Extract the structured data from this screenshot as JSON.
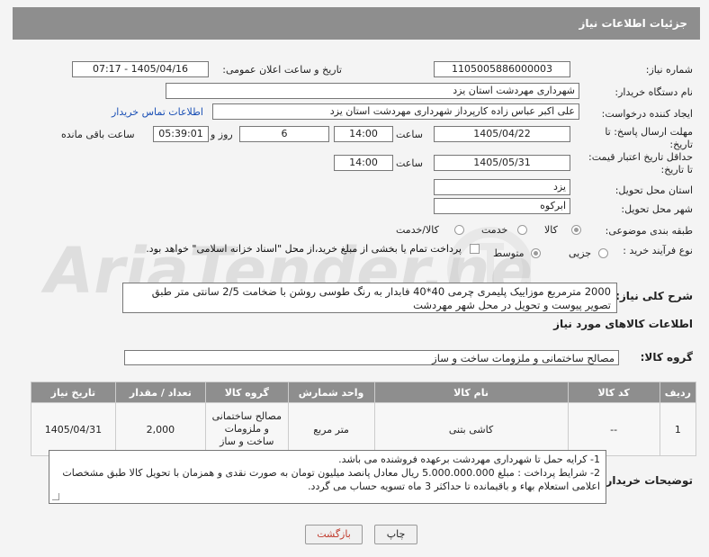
{
  "header": {
    "title": "جزئیات اطلاعات نیاز"
  },
  "form": {
    "need_number_label": "شماره نیاز:",
    "need_number": "1105005886000003",
    "announce_label": "تاریخ و ساعت اعلان عمومی:",
    "announce_value": "1405/04/16 - 07:17",
    "buyer_org_label": "نام دستگاه خریدار:",
    "buyer_org": "شهرداری مهردشت استان یزد",
    "creator_label": "ایجاد کننده درخواست:",
    "creator": "علی اکبر عباس زاده کارپرداز شهرداری مهردشت استان یزد",
    "contact_link": "اطلاعات تماس خریدار",
    "deadline_label_1": "مهلت ارسال پاسخ: تا",
    "deadline_label_2": "تاریخ:",
    "deadline_date": "1405/04/22",
    "time_label": "ساعت",
    "deadline_time": "14:00",
    "days_value": "6",
    "days_label": "روز و",
    "remaining_time": "05:39:01",
    "remaining_label": "ساعت باقی مانده",
    "price_valid_label_1": "حداقل تاریخ اعتبار قیمت:",
    "price_valid_label_2": "تا تاریخ:",
    "price_valid_date": "1405/05/31",
    "price_valid_time": "14:00",
    "province_label": "استان محل تحویل:",
    "province": "یزد",
    "city_label": "شهر محل تحویل:",
    "city": "ابرکوه",
    "category_label": "طبقه بندی موضوعی:",
    "category_options": [
      "کالا",
      "خدمت",
      "کالا/خدمت"
    ],
    "purchase_type_label": "نوع فرآیند خرید :",
    "purchase_options": [
      "جزیی",
      "متوسط"
    ],
    "payment_note": "پرداخت تمام یا بخشی از مبلغ خرید،از محل \"اسناد خزانه اسلامی\" خواهد بود."
  },
  "description": {
    "label": "شرح کلی نیاز:",
    "text": "2000 مترمربع موزاییک پلیمری چرمی 40*40 فابدار به رنگ طوسی روشن با ضخامت 2/5 سانتی متر طبق تصویر پیوست و تحویل در محل شهر مهردشت"
  },
  "goods_section_title": "اطلاعات کالاهای مورد نیاز",
  "goods_group": {
    "label": "گروه کالا:",
    "value": "مصالح ساختمانی و ملزومات ساخت و ساز"
  },
  "table": {
    "headers": [
      "ردیف",
      "کد کالا",
      "نام کالا",
      "واحد شمارش",
      "گروه کالا",
      "تعداد / مقدار",
      "تاریخ نیاز"
    ],
    "rows": [
      [
        "1",
        "--",
        "کاشی بتنی",
        "متر مربع",
        "مصالح ساختمانی و ملزومات ساخت و ساز",
        "2,000",
        "1405/04/31"
      ]
    ]
  },
  "buyer_notes": {
    "label": "توضیحات خریدار:",
    "line1": "1- کرایه حمل تا شهرداری مهردشت برعهده فروشنده می باشد.",
    "line2": "2- شرایط پرداخت : مبلغ 5.000.000.000 ریال معادل پانصد میلیون تومان به صورت نقدی و همزمان با تحویل کالا طبق مشخصات اعلامی استعلام بهاء و باقیمانده تا حداکثر 3 ماه تسویه حساب می گردد."
  },
  "buttons": {
    "print": "چاپ",
    "back": "بازگشت"
  },
  "watermark": {
    "text": "AriaTender.net"
  },
  "colors": {
    "header_bg": "#8e8e8e",
    "back_text": "#c0392b",
    "link": "#1a4fb5"
  }
}
